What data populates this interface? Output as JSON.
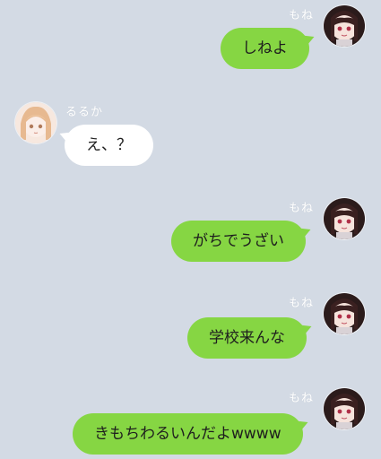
{
  "messages": [
    {
      "sender": "もね",
      "text": "しねよ",
      "direction": "outgoing"
    },
    {
      "sender": "るるか",
      "text": "え、？",
      "direction": "incoming"
    },
    {
      "sender": "もね",
      "text": "がちでうざい",
      "direction": "outgoing"
    },
    {
      "sender": "もね",
      "text": "学校来んな",
      "direction": "outgoing"
    },
    {
      "sender": "もね",
      "text": "きもちわるいんだよwwww",
      "direction": "outgoing"
    }
  ],
  "colors": {
    "background": "#d3dae4",
    "outgoing_bubble": "#86d643",
    "incoming_bubble": "#ffffff"
  },
  "icons": {
    "monet_avatar": "anime-girl-dark-hair-avatar",
    "ruruka_avatar": "anime-girl-blonde-avatar"
  }
}
